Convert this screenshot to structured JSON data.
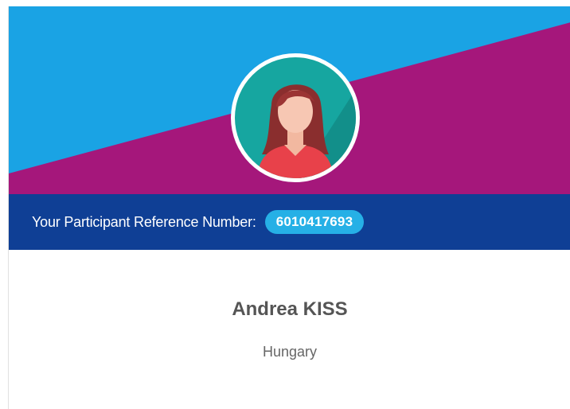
{
  "participant": {
    "reference_label": "Your Participant Reference Number:",
    "reference_number": "6010417693",
    "name": "Andrea KISS",
    "country": "Hungary"
  },
  "colors": {
    "banner_blue": "#1aa3e4",
    "banner_magenta": "#a5177b",
    "reference_bar": "#0f3f95",
    "badge": "#26b0e6",
    "avatar_background": "#16a6a0"
  },
  "avatar": {
    "icon": "female-user-avatar-icon"
  }
}
